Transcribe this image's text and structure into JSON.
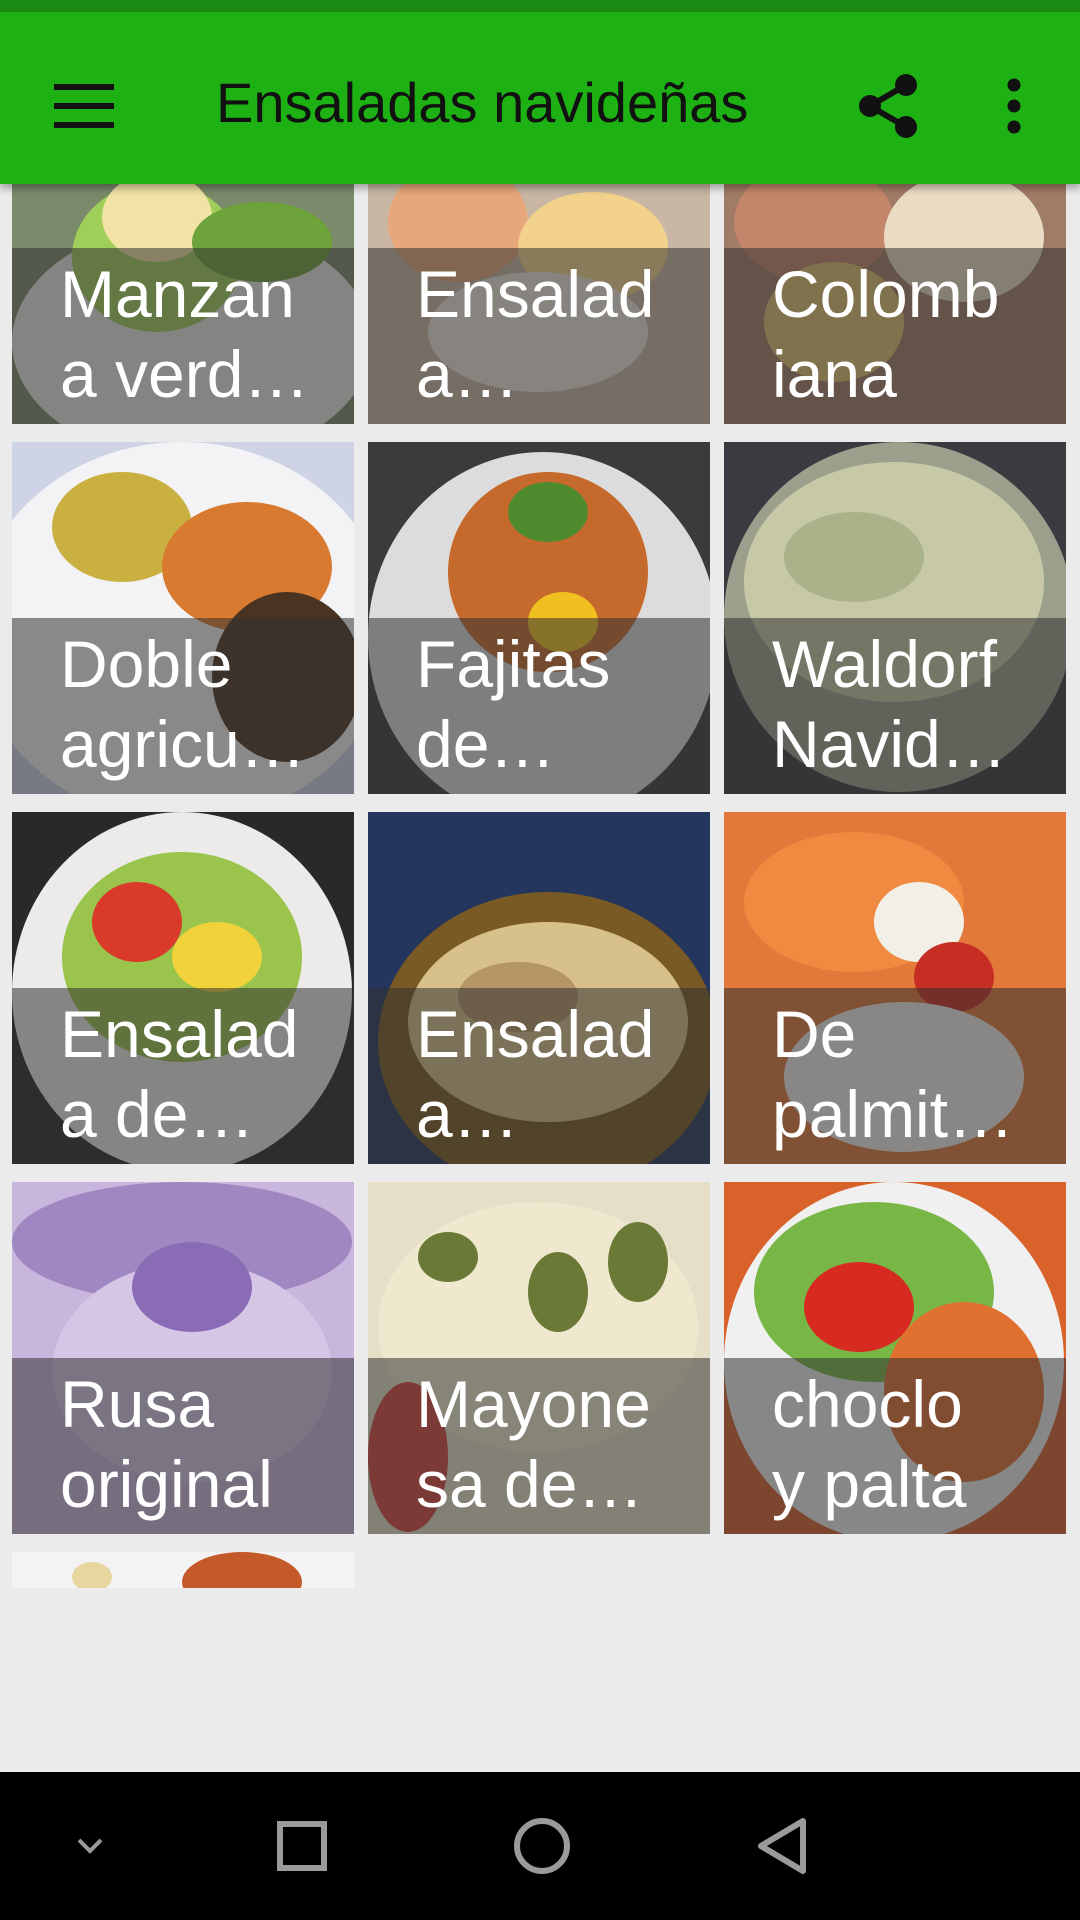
{
  "app_bar": {
    "title": "Ensaladas navideñas",
    "menu_icon": "hamburger-menu-icon",
    "share_icon": "share-icon",
    "more_icon": "more-vert-icon"
  },
  "colors": {
    "app_bar": "#1db114",
    "status_bar": "#1b8d14",
    "background": "#ebebeb"
  },
  "recipes": [
    {
      "label": "Manzan\na verd…"
    },
    {
      "label": "Ensalad\na…"
    },
    {
      "label": "Colomb\niana"
    },
    {
      "label": "Doble\nagricu…"
    },
    {
      "label": "Fajitas\nde…"
    },
    {
      "label": "Waldorf\nNavid…"
    },
    {
      "label": "Ensalad\na de…"
    },
    {
      "label": "Ensalad\na…"
    },
    {
      "label": "De\npalmit…"
    },
    {
      "label": "Rusa\noriginal"
    },
    {
      "label": "Mayone\nsa de…"
    },
    {
      "label": "choclo\ny palta"
    }
  ],
  "nav": {
    "collapse_icon": "chevron-down-icon",
    "recents_icon": "square-recents-icon",
    "home_icon": "circle-home-icon",
    "back_icon": "triangle-back-icon"
  }
}
